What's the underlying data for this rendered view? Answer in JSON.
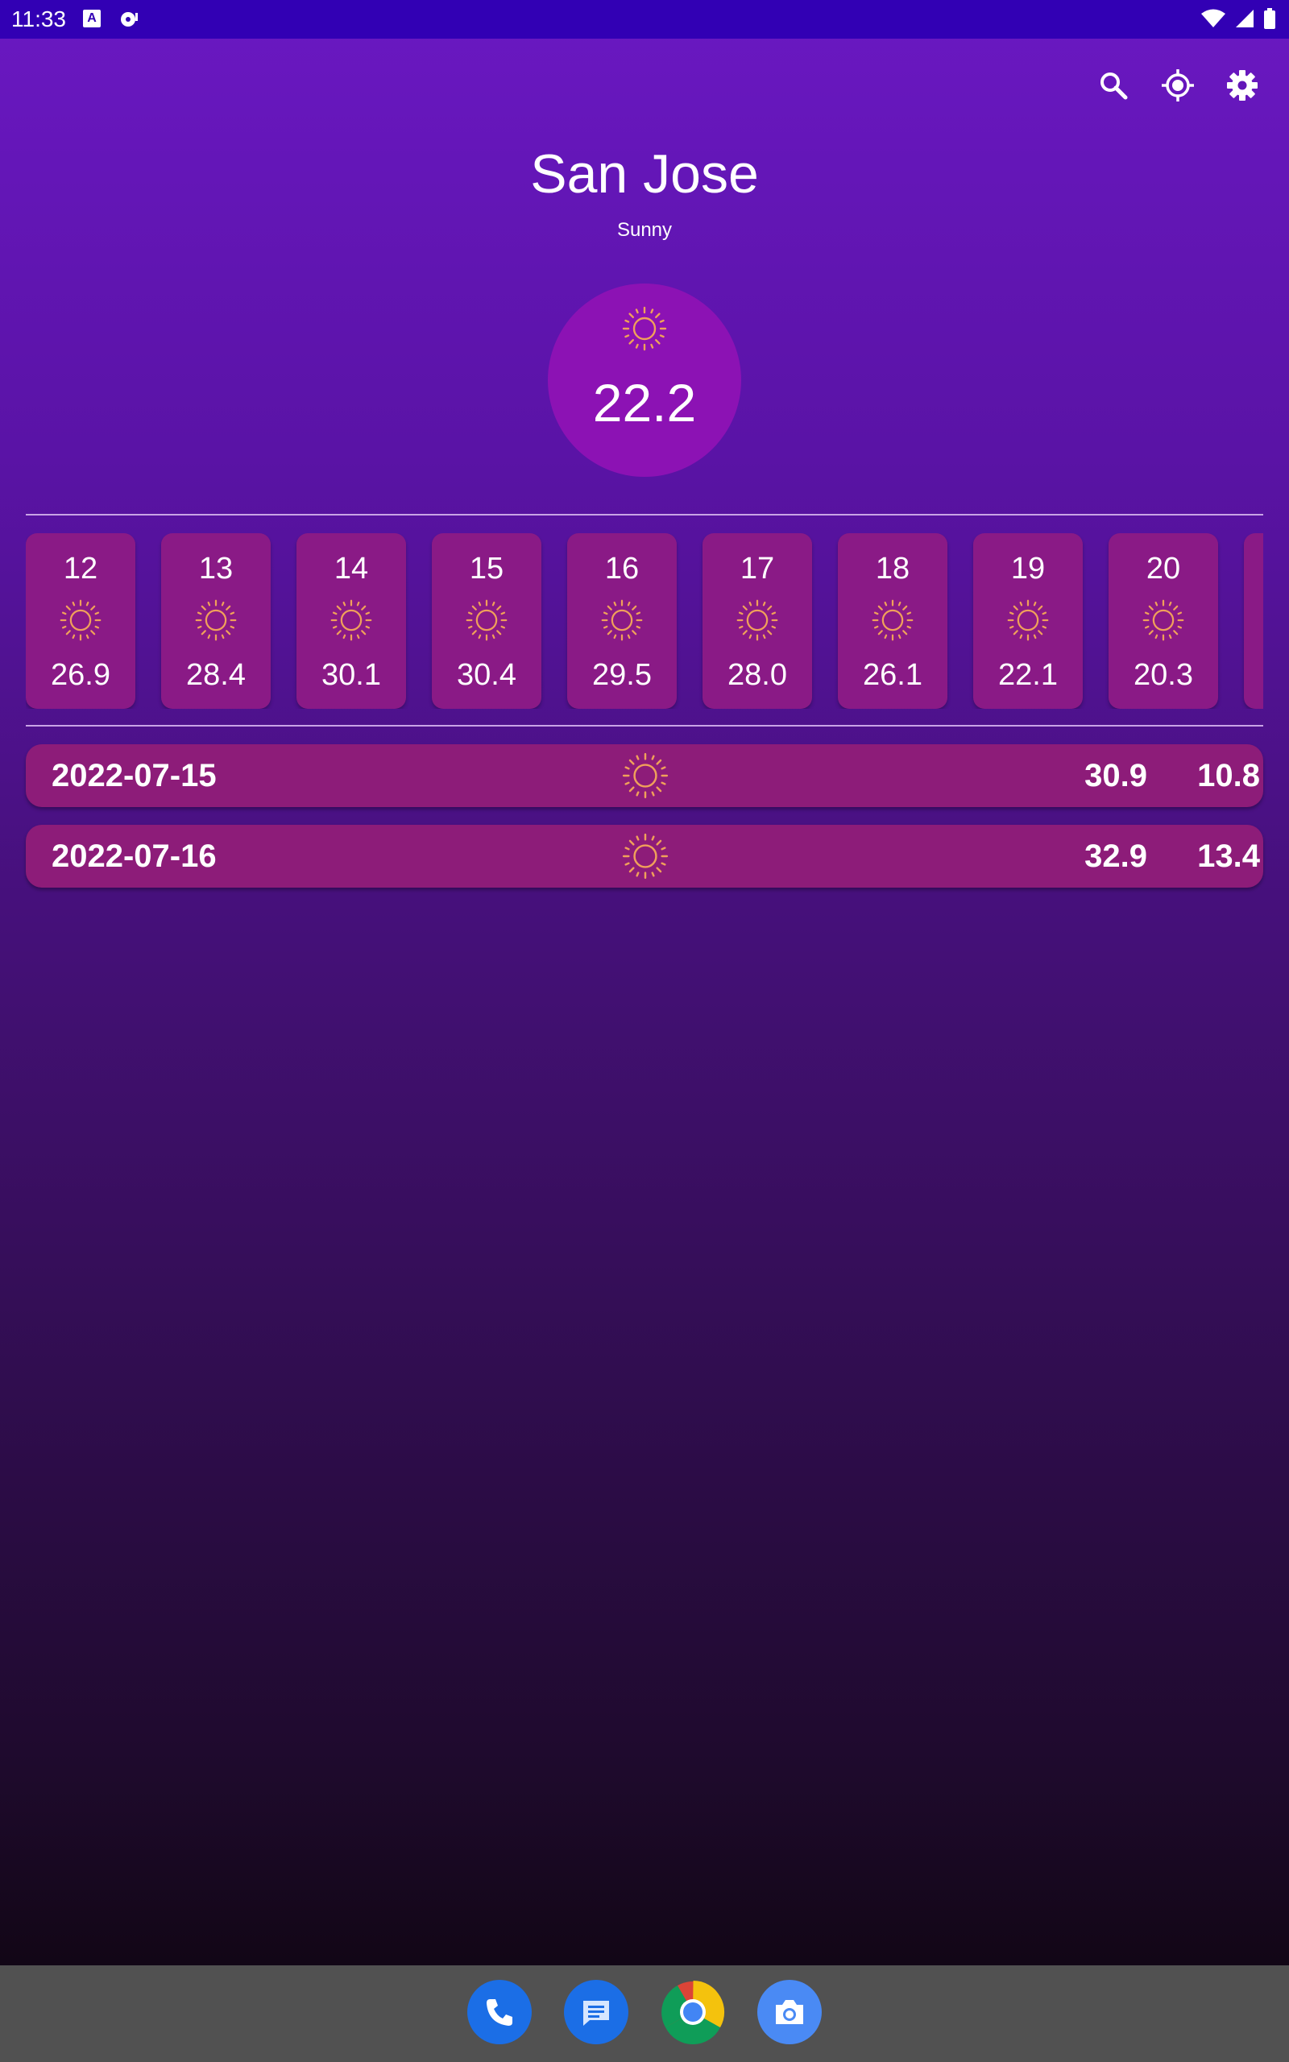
{
  "status_bar": {
    "time": "11:33",
    "a_icon": "A",
    "icons": [
      "text-a-icon",
      "sync-icon",
      "wifi-icon",
      "signal-icon",
      "battery-icon"
    ]
  },
  "toolbar": {
    "icons": [
      "search-icon",
      "my-location-icon",
      "settings-icon"
    ]
  },
  "location": {
    "city": "San Jose",
    "condition": "Sunny"
  },
  "current": {
    "temperature": "22.2",
    "icon": "sun-icon"
  },
  "hourly": [
    {
      "hour": "12",
      "temp": "26.9"
    },
    {
      "hour": "13",
      "temp": "28.4"
    },
    {
      "hour": "14",
      "temp": "30.1"
    },
    {
      "hour": "15",
      "temp": "30.4"
    },
    {
      "hour": "16",
      "temp": "29.5"
    },
    {
      "hour": "17",
      "temp": "28.0"
    },
    {
      "hour": "18",
      "temp": "26.1"
    },
    {
      "hour": "19",
      "temp": "22.1"
    },
    {
      "hour": "20",
      "temp": "20.3"
    }
  ],
  "daily": [
    {
      "date": "2022-07-15",
      "high": "30.9",
      "low": "10.8"
    },
    {
      "date": "2022-07-16",
      "high": "32.9",
      "low": "13.4"
    }
  ],
  "dock": [
    "phone-app-icon",
    "messages-app-icon",
    "chrome-app-icon",
    "camera-app-icon"
  ],
  "colors": {
    "status_bar": "#3200b4",
    "card": "#8a1a86",
    "circle": "#8c12b4",
    "sun": "#f0a05a"
  }
}
